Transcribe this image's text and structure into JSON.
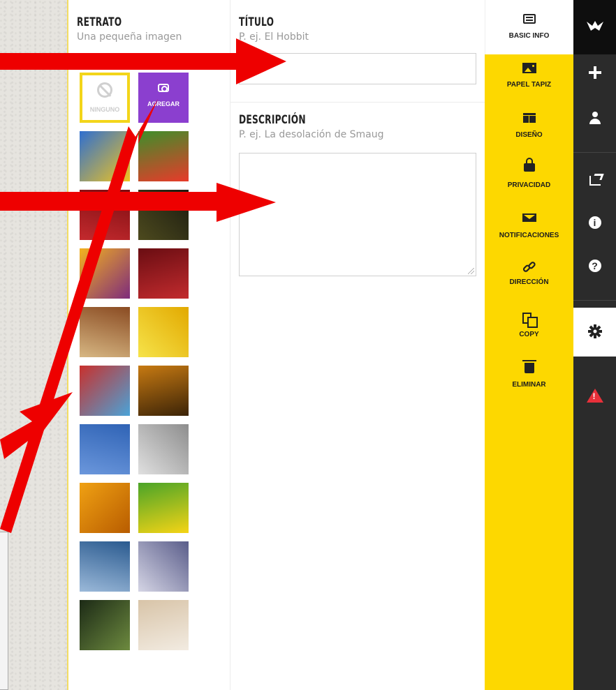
{
  "portrait": {
    "title": "RETRATO",
    "subtitle": "Una pequeña imagen",
    "none_label": "NINGUNO",
    "add_label": "AGREGAR",
    "image_tiles": [
      {
        "name": "fireworks-image",
        "c1": "#2f6fd0",
        "c2": "#f0c420"
      },
      {
        "name": "soccer-image",
        "c1": "#3d8f2a",
        "c2": "#e83a2a"
      },
      {
        "name": "red-rose-image",
        "c1": "#7a0c10",
        "c2": "#c42a2e"
      },
      {
        "name": "dark-texture-image",
        "c1": "#1a1a10",
        "c2": "#4d4a1e"
      },
      {
        "name": "origami-crane-image",
        "c1": "#f3b21f",
        "c2": "#7e2b7c"
      },
      {
        "name": "numbers-image",
        "c1": "#6a0d12",
        "c2": "#c22b2e"
      },
      {
        "name": "notebook-image",
        "c1": "#8a4b22",
        "c2": "#d7b783"
      },
      {
        "name": "sticky-note-checklist-image",
        "c1": "#e2a900",
        "c2": "#f6e34a"
      },
      {
        "name": "birthday-cake-image",
        "c1": "#c9302c",
        "c2": "#4aa3d8"
      },
      {
        "name": "people-silhouettes-image",
        "c1": "#c77a12",
        "c2": "#3b2307"
      },
      {
        "name": "globe-image",
        "c1": "#2f63b5",
        "c2": "#6b97dc"
      },
      {
        "name": "pocket-watch-image",
        "c1": "#8d8d8d",
        "c2": "#e0e0e0"
      },
      {
        "name": "megaphone-image",
        "c1": "#f0a113",
        "c2": "#b85c00"
      },
      {
        "name": "smiley-face-image",
        "c1": "#4aa428",
        "c2": "#f5d416"
      },
      {
        "name": "scales-of-justice-image",
        "c1": "#2a5a8f",
        "c2": "#9bb9d9"
      },
      {
        "name": "wedding-couple-image",
        "c1": "#5a5d8a",
        "c2": "#d5d5e5"
      },
      {
        "name": "chimpanzee-image",
        "c1": "#1c2a16",
        "c2": "#6d8a3f"
      },
      {
        "name": "babies-image",
        "c1": "#d8c4a8",
        "c2": "#f2ebe1"
      }
    ]
  },
  "form": {
    "title_label": "TÍTULO",
    "title_placeholder": "P. ej. El Hobbit",
    "title_value": "",
    "desc_label": "DESCRIPCIÓN",
    "desc_placeholder": "P. ej. La desolación de Smaug",
    "desc_value": ""
  },
  "menu": {
    "items": [
      {
        "label": "BASIC INFO",
        "icon": "newspaper-icon"
      },
      {
        "label": "PAPEL TAPIZ",
        "icon": "picture-icon"
      },
      {
        "label": "DISEÑO",
        "icon": "layout-icon"
      },
      {
        "label": "PRIVACIDAD",
        "icon": "lock-icon"
      },
      {
        "label": "NOTIFICACIONES",
        "icon": "envelope-icon"
      },
      {
        "label": "DIRECCIÓN",
        "icon": "link-icon"
      },
      {
        "label": "COPY",
        "icon": "copy-icon"
      },
      {
        "label": "ELIMINAR",
        "icon": "trash-icon"
      }
    ]
  },
  "sidebar": {
    "icons": [
      "crane-logo-icon",
      "plus-icon",
      "user-icon",
      "share-icon",
      "info-icon",
      "help-icon",
      "gear-icon",
      "warning-icon"
    ],
    "info_glyph": "i",
    "help_glyph": "?"
  },
  "colors": {
    "accent_yellow": "#fdd800",
    "add_purple": "#8b3fcf",
    "sidebar_dark": "#2b2b2b",
    "arrow_red": "#ee0000",
    "warning_red": "#e8303a"
  }
}
